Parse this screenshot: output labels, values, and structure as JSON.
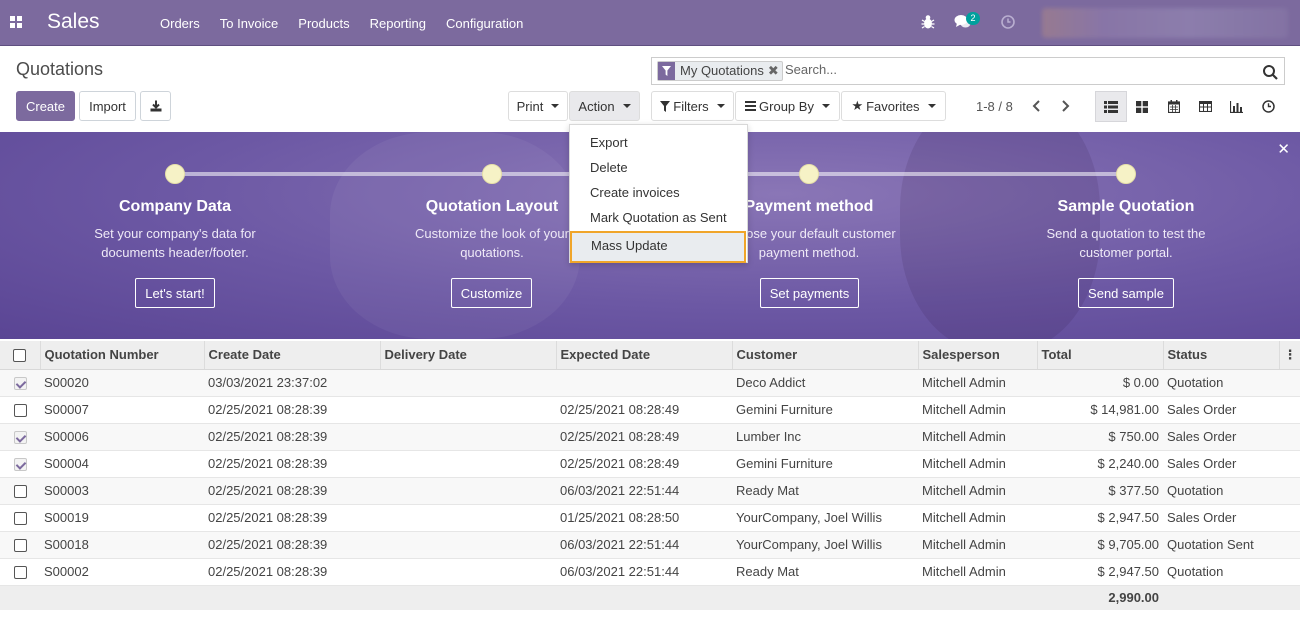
{
  "navbar": {
    "brand": "Sales",
    "menu": [
      "Orders",
      "To Invoice",
      "Products",
      "Reporting",
      "Configuration"
    ],
    "chat_badge": "2"
  },
  "control": {
    "breadcrumb": "Quotations",
    "create_label": "Create",
    "import_label": "Import",
    "print_label": "Print",
    "action_label": "Action",
    "filters_label": "Filters",
    "groupby_label": "Group By",
    "favorites_label": "Favorites",
    "facet_label": "My Quotations",
    "search_placeholder": "Search...",
    "pager_value": "1-8 / 8"
  },
  "action_menu": {
    "items": [
      "Export",
      "Delete",
      "Create invoices",
      "Mark Quotation as Sent",
      "Mass Update"
    ]
  },
  "banner": {
    "steps": [
      {
        "title": "Company Data",
        "desc": "Set your company's data for documents header/footer.",
        "button": "Let's start!"
      },
      {
        "title": "Quotation Layout",
        "desc": "Customize the look of your quotations.",
        "button": "Customize"
      },
      {
        "title": "Payment method",
        "desc": "Choose your default customer payment method.",
        "button": "Set payments"
      },
      {
        "title": "Sample Quotation",
        "desc": "Send a quotation to test the customer portal.",
        "button": "Send sample"
      }
    ]
  },
  "table": {
    "headers": {
      "number": "Quotation Number",
      "create_date": "Create Date",
      "delivery_date": "Delivery Date",
      "expected_date": "Expected Date",
      "customer": "Customer",
      "salesperson": "Salesperson",
      "total": "Total",
      "status": "Status"
    },
    "rows": [
      {
        "checked": true,
        "number": "S00020",
        "create_date": "03/03/2021 23:37:02",
        "delivery_date": "",
        "expected_date": "",
        "customer": "Deco Addict",
        "salesperson": "Mitchell Admin",
        "total": "$ 0.00",
        "status": "Quotation"
      },
      {
        "checked": false,
        "number": "S00007",
        "create_date": "02/25/2021 08:28:39",
        "delivery_date": "",
        "expected_date": "02/25/2021 08:28:49",
        "customer": "Gemini Furniture",
        "salesperson": "Mitchell Admin",
        "total": "$ 14,981.00",
        "status": "Sales Order"
      },
      {
        "checked": true,
        "number": "S00006",
        "create_date": "02/25/2021 08:28:39",
        "delivery_date": "",
        "expected_date": "02/25/2021 08:28:49",
        "customer": "Lumber Inc",
        "salesperson": "Mitchell Admin",
        "total": "$ 750.00",
        "status": "Sales Order"
      },
      {
        "checked": true,
        "number": "S00004",
        "create_date": "02/25/2021 08:28:39",
        "delivery_date": "",
        "expected_date": "02/25/2021 08:28:49",
        "customer": "Gemini Furniture",
        "salesperson": "Mitchell Admin",
        "total": "$ 2,240.00",
        "status": "Sales Order"
      },
      {
        "checked": false,
        "number": "S00003",
        "create_date": "02/25/2021 08:28:39",
        "delivery_date": "",
        "expected_date": "06/03/2021 22:51:44",
        "customer": "Ready Mat",
        "salesperson": "Mitchell Admin",
        "total": "$ 377.50",
        "status": "Quotation"
      },
      {
        "checked": false,
        "number": "S00019",
        "create_date": "02/25/2021 08:28:39",
        "delivery_date": "",
        "expected_date": "01/25/2021 08:28:50",
        "customer": "YourCompany, Joel Willis",
        "salesperson": "Mitchell Admin",
        "total": "$ 2,947.50",
        "status": "Sales Order"
      },
      {
        "checked": false,
        "number": "S00018",
        "create_date": "02/25/2021 08:28:39",
        "delivery_date": "",
        "expected_date": "06/03/2021 22:51:44",
        "customer": "YourCompany, Joel Willis",
        "salesperson": "Mitchell Admin",
        "total": "$ 9,705.00",
        "status": "Quotation Sent"
      },
      {
        "checked": false,
        "number": "S00002",
        "create_date": "02/25/2021 08:28:39",
        "delivery_date": "",
        "expected_date": "06/03/2021 22:51:44",
        "customer": "Ready Mat",
        "salesperson": "Mitchell Admin",
        "total": "$ 2,947.50",
        "status": "Quotation"
      }
    ],
    "footer_total": "2,990.00"
  },
  "colors": {
    "brand": "#7c6a9e",
    "focus_outline": "#f0a52a"
  }
}
